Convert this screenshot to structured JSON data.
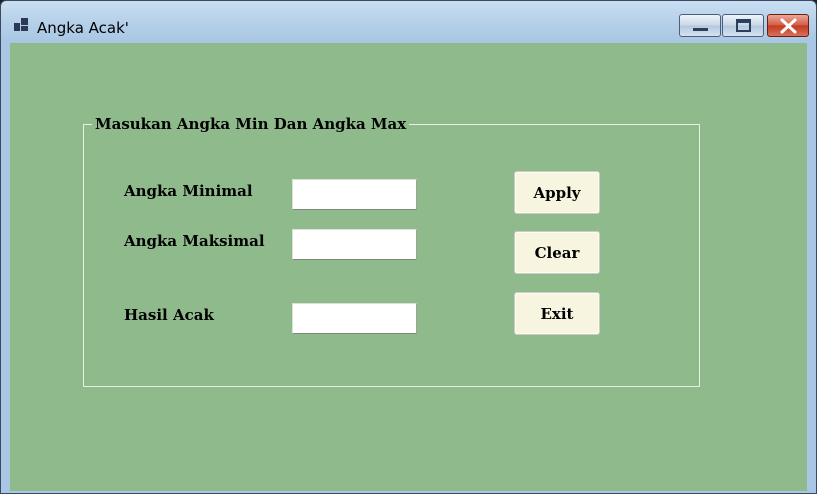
{
  "window": {
    "title": "Angka Acak'",
    "accent_color": "#8fbb8c"
  },
  "icons": {
    "app": "app-window-icon",
    "minimize": "minimize-icon",
    "maximize": "maximize-icon",
    "close": "close-icon"
  },
  "form": {
    "group_title": "Masukan Angka Min Dan Angka Max",
    "min_label": "Angka Minimal",
    "max_label": "Angka Maksimal",
    "result_label": "Hasil Acak",
    "min_value": "",
    "max_value": "",
    "result_value": "",
    "apply_label": "Apply",
    "clear_label": "Clear",
    "exit_label": "Exit"
  }
}
